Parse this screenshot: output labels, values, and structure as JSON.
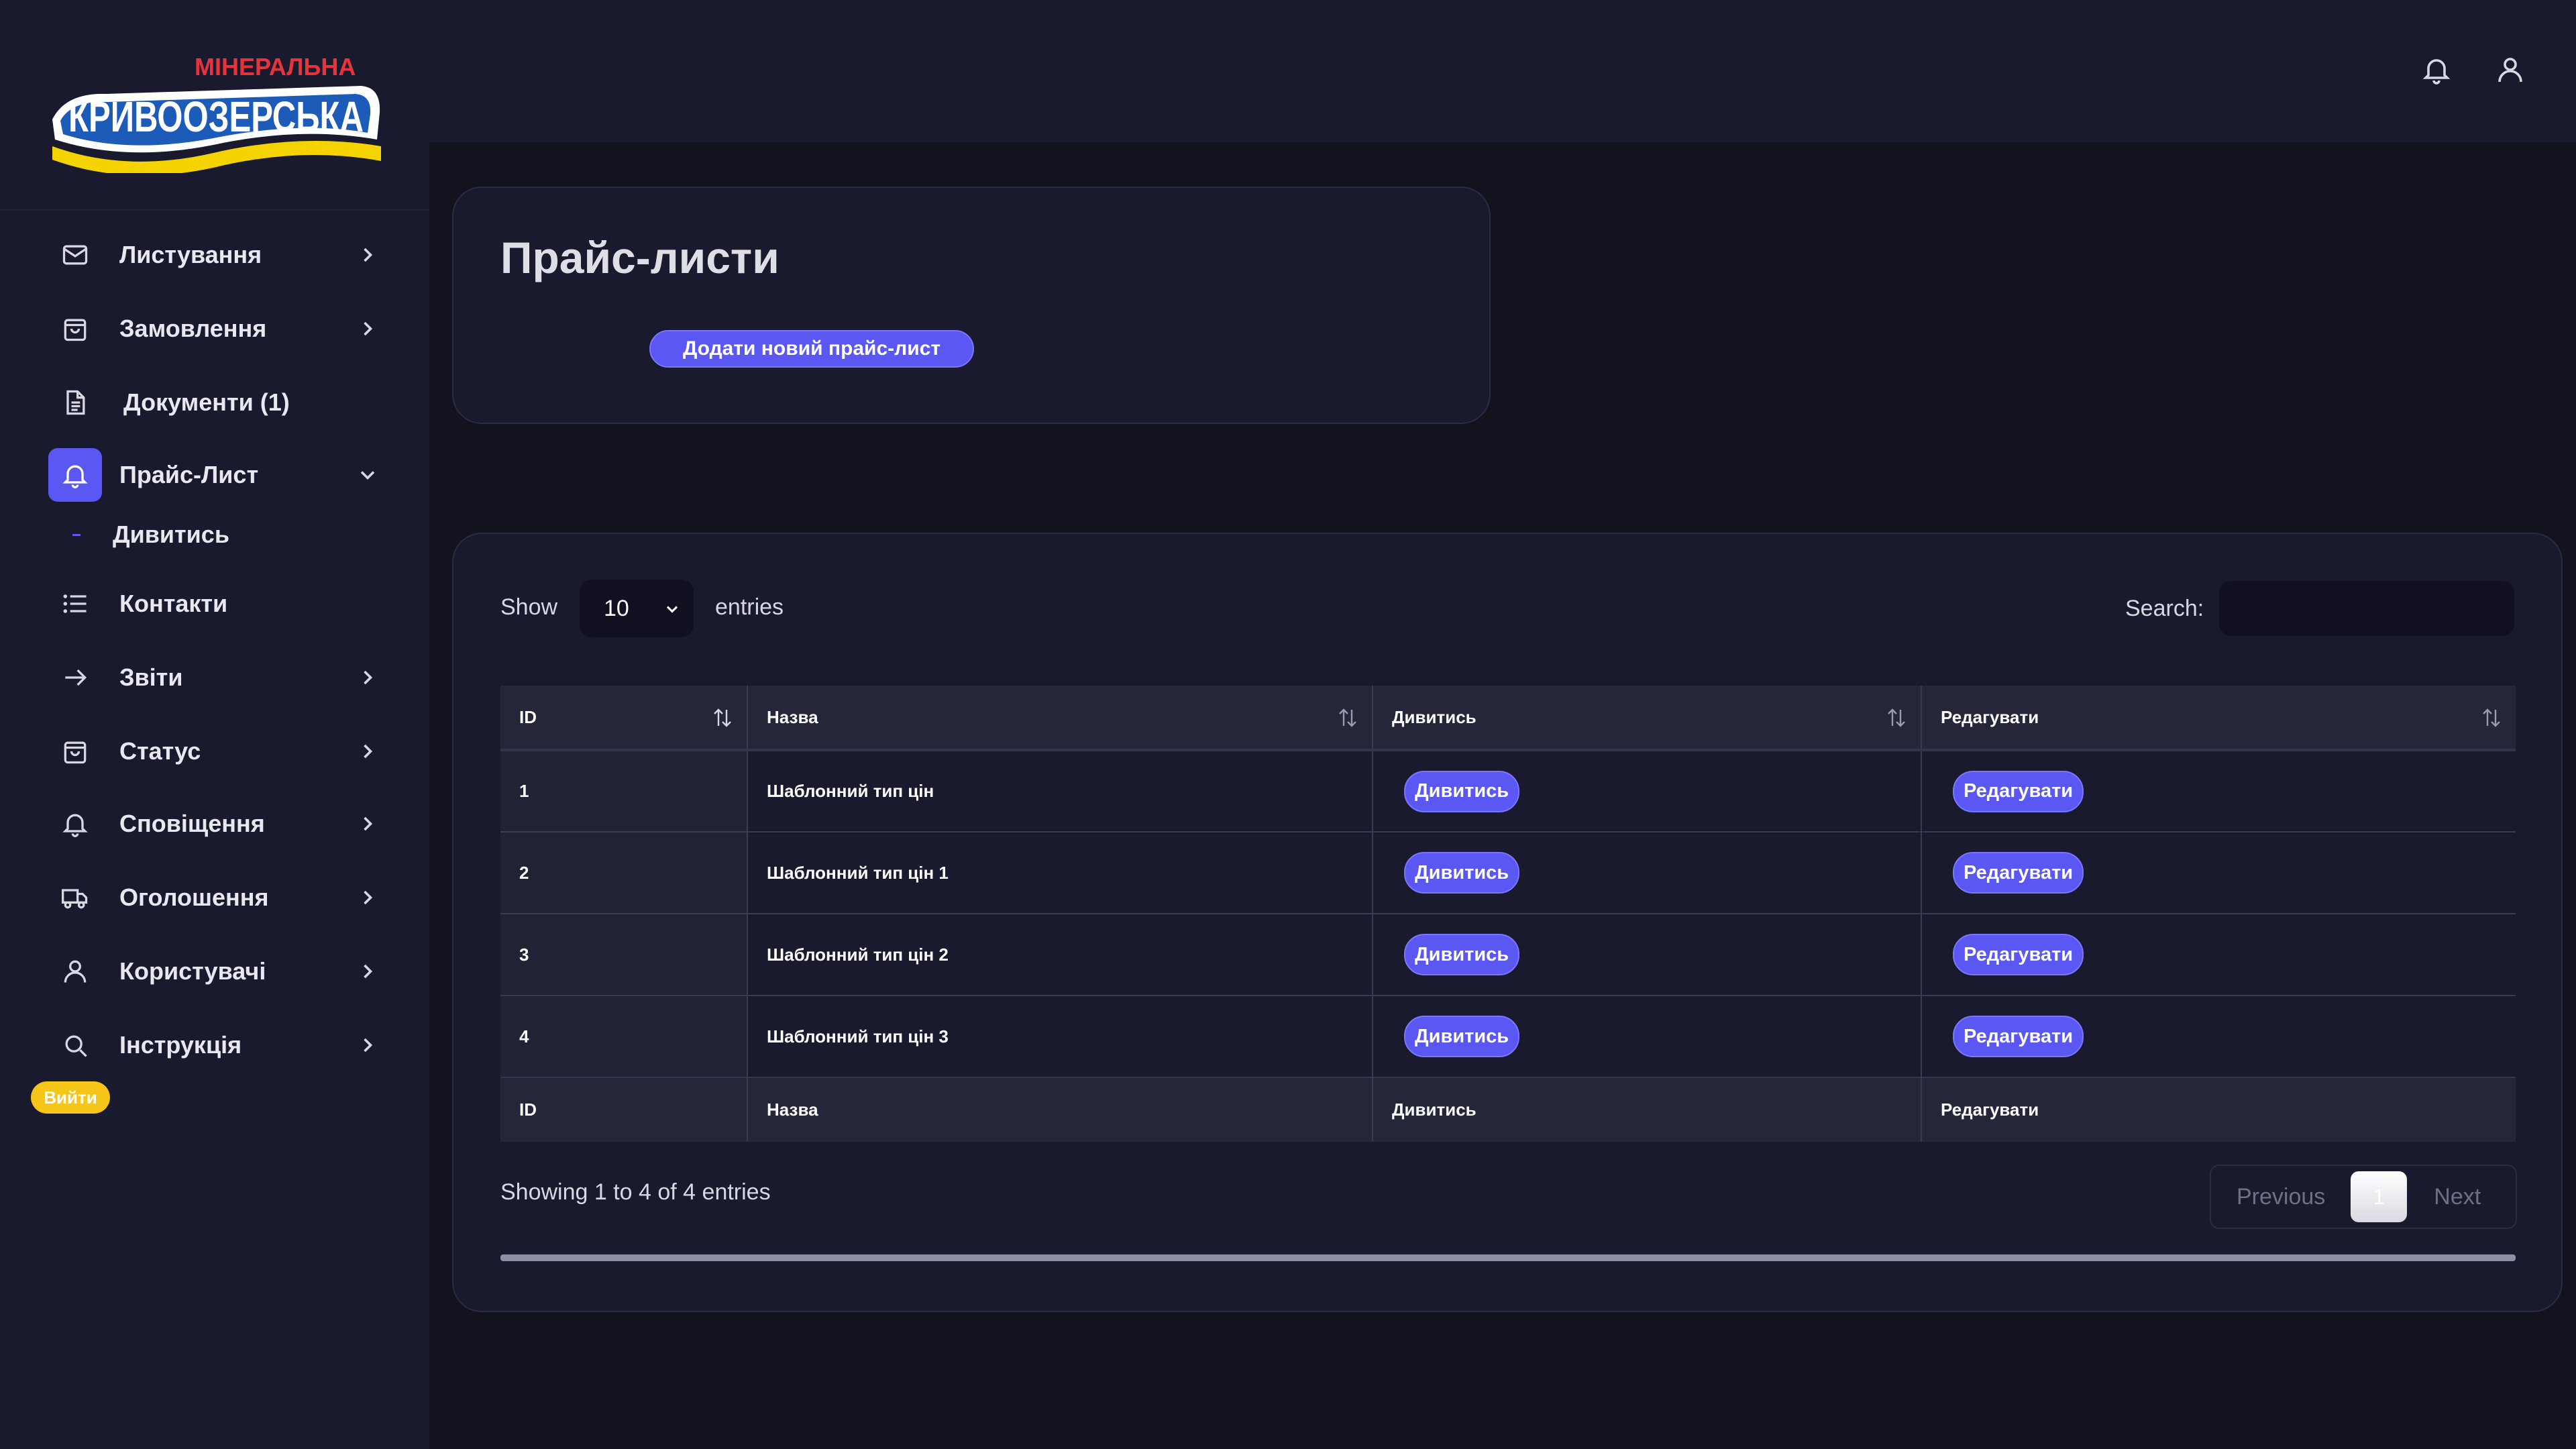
{
  "brand": {
    "logo_top": "МІНЕРАЛЬНА",
    "logo_main": "КРИВООЗЕРСЬКА"
  },
  "sidebar": {
    "items": [
      {
        "label": "Листування",
        "icon": "mail-icon"
      },
      {
        "label": "Замовлення",
        "icon": "shopping-bag-icon"
      },
      {
        "label": "Документи (1)",
        "icon": "document-icon"
      },
      {
        "label": "Прайс-Лист",
        "icon": "bell-icon"
      },
      {
        "label": "Контакти",
        "icon": "list-icon"
      },
      {
        "label": "Звіти",
        "icon": "arrow-right-icon"
      },
      {
        "label": "Статус",
        "icon": "shopping-bag-icon"
      },
      {
        "label": "Сповіщення",
        "icon": "bell-icon"
      },
      {
        "label": "Оголошення",
        "icon": "truck-icon"
      },
      {
        "label": "Користувачі",
        "icon": "user-icon"
      },
      {
        "label": "Інструкція",
        "icon": "search-icon"
      }
    ],
    "sub_item": "Дивитись",
    "logout": "Вийти"
  },
  "page": {
    "title": "Прайс-листи",
    "add_button": "Додати новий прайс-лист"
  },
  "table_controls": {
    "show": "Show",
    "entries_value": "10",
    "entries": "entries",
    "search_label": "Search:",
    "search_value": ""
  },
  "table": {
    "headers": [
      "ID",
      "Назва",
      "Дивитись",
      "Редагувати"
    ],
    "rows": [
      {
        "id": "1",
        "name": "Шаблонний тип цін",
        "view": "Дивитись",
        "edit": "Редагувати"
      },
      {
        "id": "2",
        "name": "Шаблонний тип цін 1",
        "view": "Дивитись",
        "edit": "Редагувати"
      },
      {
        "id": "3",
        "name": "Шаблонний тип цін 2",
        "view": "Дивитись",
        "edit": "Редагувати"
      },
      {
        "id": "4",
        "name": "Шаблонний тип цін 3",
        "view": "Дивитись",
        "edit": "Редагувати"
      }
    ],
    "footers": [
      "ID",
      "Назва",
      "Дивитись",
      "Редагувати"
    ]
  },
  "pagination": {
    "info": "Showing 1 to 4 of 4 entries",
    "previous": "Previous",
    "page": "1",
    "next": "Next"
  },
  "colors": {
    "accent": "#5b57f2",
    "sidebar_bg": "#191a2d",
    "page_bg": "#13131f",
    "logout": "#f5c518"
  }
}
